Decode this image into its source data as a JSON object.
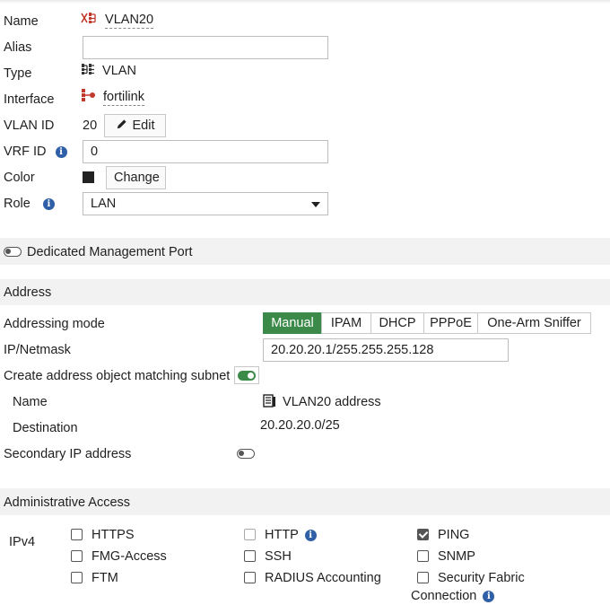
{
  "form": {
    "name_label": "Name",
    "name_value": "VLAN20",
    "alias_label": "Alias",
    "alias_value": "",
    "type_label": "Type",
    "type_value": "VLAN",
    "interface_label": "Interface",
    "interface_value": "fortilink",
    "vlan_id_label": "VLAN ID",
    "vlan_id_value": "20",
    "edit_button": "Edit",
    "vrf_id_label": "VRF ID",
    "vrf_id_value": "0",
    "color_label": "Color",
    "color_swatch": "#222222",
    "change_button": "Change",
    "role_label": "Role",
    "role_value": "LAN"
  },
  "dedicated_mgmt": {
    "label": "Dedicated Management Port",
    "enabled": false
  },
  "address": {
    "section_title": "Address",
    "addressing_mode_label": "Addressing mode",
    "modes": [
      "Manual",
      "IPAM",
      "DHCP",
      "PPPoE",
      "One-Arm Sniffer"
    ],
    "active_mode": "Manual",
    "ip_netmask_label": "IP/Netmask",
    "ip_netmask_value": "20.20.20.1/255.255.255.128",
    "create_object_label": "Create address object matching subnet",
    "create_object_enabled": true,
    "object_name_label": "Name",
    "object_name_value": "VLAN20 address",
    "destination_label": "Destination",
    "destination_value": "20.20.20.0/25",
    "secondary_ip_label": "Secondary IP address",
    "secondary_ip_enabled": false
  },
  "admin_access": {
    "section_title": "Administrative Access",
    "ipv4_label": "IPv4",
    "options": {
      "https": {
        "label": "HTTPS",
        "checked": false
      },
      "fmg_access": {
        "label": "FMG-Access",
        "checked": false
      },
      "ftm": {
        "label": "FTM",
        "checked": false
      },
      "http": {
        "label": "HTTP",
        "checked": false
      },
      "ssh": {
        "label": "SSH",
        "checked": false
      },
      "radius": {
        "label": "RADIUS Accounting",
        "checked": false
      },
      "ping": {
        "label": "PING",
        "checked": true
      },
      "snmp": {
        "label": "SNMP",
        "checked": false
      },
      "sec_fabric": {
        "label": "Security Fabric",
        "label2": "Connection",
        "checked": false
      }
    }
  },
  "colors": {
    "accent_green": "#3c8a4a",
    "info_blue": "#2f5fa6",
    "interface_red": "#c0392b"
  },
  "icons": [
    "vlan-interface-icon",
    "vlan-type-icon",
    "fortilink-icon",
    "pencil-icon",
    "info-icon",
    "address-object-icon"
  ]
}
